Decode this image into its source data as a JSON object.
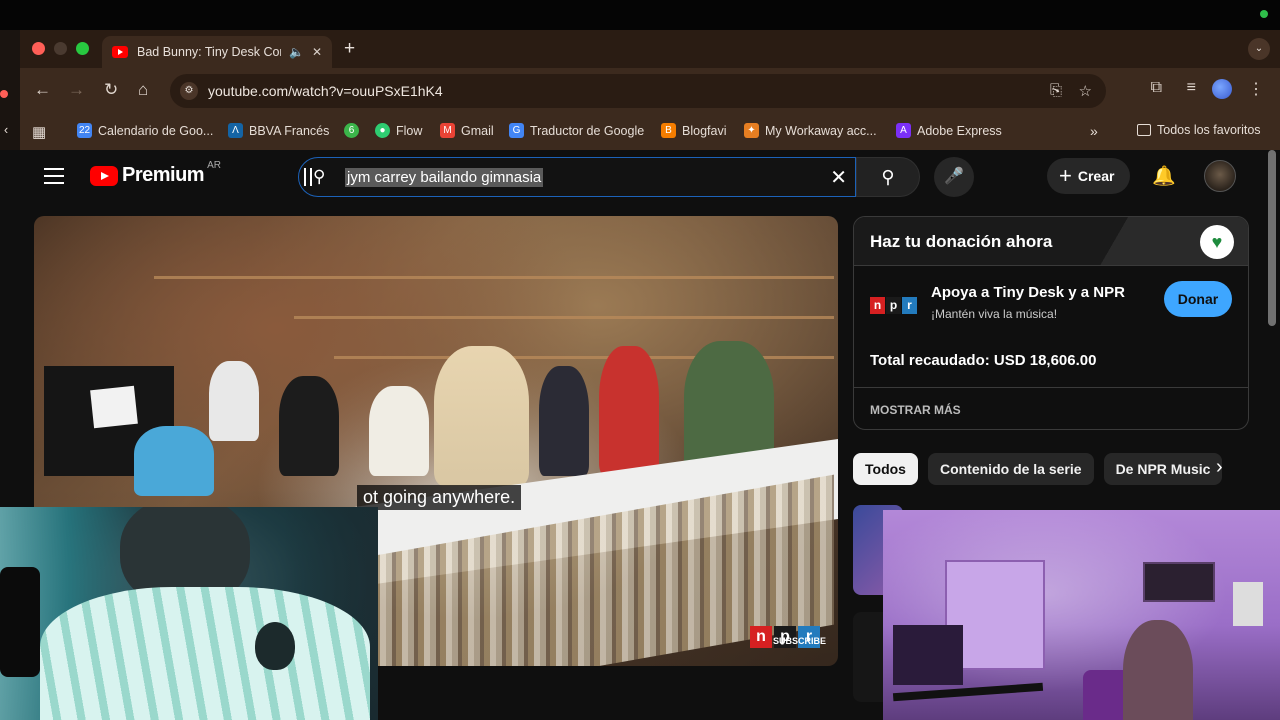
{
  "browser": {
    "tab_title": "Bad Bunny: Tiny Desk Concert",
    "tab_audio_icon": "speaker-icon",
    "tab_close_icon": "close-icon",
    "new_tab_icon": "plus-icon",
    "url": "youtube.com/watch?v=ouuPSxE1hK4",
    "bookmarks": [
      {
        "label": "Calendario de Goo...",
        "color": "#4285f4",
        "glyph": "22"
      },
      {
        "label": "BBVA Francés",
        "color": "#1464a5",
        "glyph": "Λ"
      },
      {
        "label": "",
        "color": "#3bb54a",
        "glyph": "6"
      },
      {
        "label": "Flow",
        "color": "#2ecc71",
        "glyph": "●"
      },
      {
        "label": "Gmail",
        "color": "#ea4335",
        "glyph": "M"
      },
      {
        "label": "Traductor de Google",
        "color": "#4285f4",
        "glyph": "G"
      },
      {
        "label": "Blogfavi",
        "color": "#f57d00",
        "glyph": "B"
      },
      {
        "label": "My Workaway acc...",
        "color": "#e67e22",
        "glyph": "✦"
      },
      {
        "label": "Adobe Express",
        "color": "#7b2ff7",
        "glyph": "A"
      }
    ],
    "all_favorites": "Todos los favoritos"
  },
  "youtube": {
    "logo_text": "Premium",
    "country_code": "AR",
    "search_value": "jym carrey bailando gimnasia",
    "create_label": "Crear",
    "caption": "ot going anywhere.",
    "npr_logo": [
      "n",
      "p",
      "r"
    ],
    "npr_subscribe": "SUBSCRIBE",
    "donation": {
      "title": "Haz tu donación ahora",
      "org_name": "Apoya a Tiny Desk y a NPR",
      "org_sub": "¡Mantén viva la música!",
      "button": "Donar",
      "total": "Total recaudado: USD 18,606.00",
      "more": "MOSTRAR MÁS"
    },
    "chips": [
      "Todos",
      "Contenido de la serie",
      "De NPR Music"
    ],
    "colors": {
      "accent": "#3ea6ff",
      "brand_red": "#ff0000",
      "npr_red": "#d62021",
      "npr_black": "#000000",
      "npr_blue": "#237bbd"
    }
  }
}
